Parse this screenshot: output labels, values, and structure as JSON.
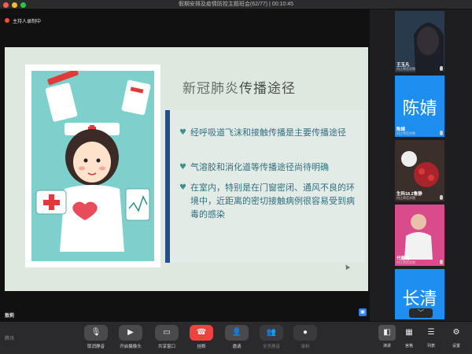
{
  "window": {
    "title": "假期安排及疫情防控主题班会(62/77) | 00:10:45"
  },
  "main": {
    "recording_label": "主持人录制中",
    "presenter_name": "敖莉",
    "slide": {
      "title_plain": "新冠肺炎",
      "title_accent": "传播途径",
      "bullets": [
        "经呼吸道飞沫和接触传播是主要传播途径",
        "气溶胶和消化道等传播途径尚待明确",
        "在室内，特别是在门窗密闭、通风不良的环境中，近距离的密切接触病例很容易受到病毒的感染"
      ]
    }
  },
  "panel": {
    "participants": [
      {
        "name": "王玉凡",
        "org": "内江师范学院",
        "avatar_text": ""
      },
      {
        "name": "陈婧",
        "org": "内江师范学院",
        "avatar_text": "陈婧"
      },
      {
        "name": "生科18.2鲁静",
        "org": "内江师范学院",
        "avatar_text": ""
      },
      {
        "name": "代春梅",
        "org": "内江师范学院",
        "avatar_text": ""
      },
      {
        "name": "",
        "org": "",
        "avatar_text": "长清"
      }
    ]
  },
  "toolbar": {
    "brand": "腾讯",
    "items": [
      {
        "label": "取消静音",
        "icon": "mic-icon"
      },
      {
        "label": "开启摄像头",
        "icon": "camera-icon"
      },
      {
        "label": "共享窗口",
        "icon": "share-window-icon"
      },
      {
        "label": "挂断",
        "icon": "hangup-icon"
      },
      {
        "label": "邀请",
        "icon": "invite-icon"
      },
      {
        "label": "全员静音",
        "icon": "mute-all-icon"
      },
      {
        "label": "录制",
        "icon": "record-icon"
      }
    ],
    "view_items": [
      {
        "label": "演讲",
        "icon": "speaker-view-icon"
      },
      {
        "label": "宫格",
        "icon": "grid-view-icon"
      },
      {
        "label": "列表",
        "icon": "list-view-icon"
      },
      {
        "label": "设置",
        "icon": "settings-icon"
      }
    ]
  },
  "colors": {
    "accent": "#2d7ff9",
    "hangup": "#f0433d",
    "slide_bar": "#1f4f8f"
  }
}
